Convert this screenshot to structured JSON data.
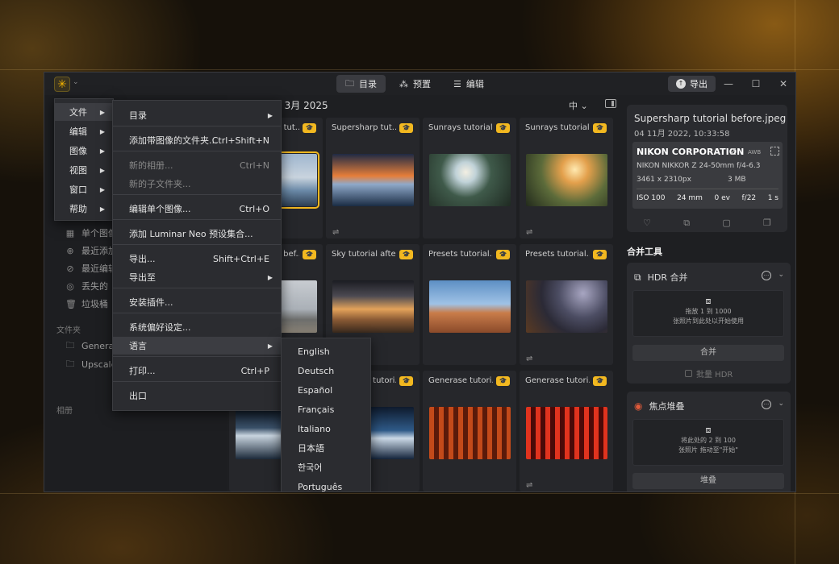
{
  "titlebar": {
    "tabs": [
      {
        "label": "目录",
        "icon": "folder-icon",
        "active": true
      },
      {
        "label": "预置",
        "icon": "magic-wand-icon",
        "active": false
      },
      {
        "label": "编辑",
        "icon": "sliders-icon",
        "active": false
      }
    ],
    "export_label": "导出"
  },
  "main_menu": {
    "items": [
      {
        "label": "文件"
      },
      {
        "label": "编辑"
      },
      {
        "label": "图像"
      },
      {
        "label": "视图"
      },
      {
        "label": "窗口"
      },
      {
        "label": "帮助"
      }
    ]
  },
  "file_menu": {
    "items": [
      {
        "label": "目录",
        "shortcut": "",
        "submenu": true,
        "disabled": false
      },
      {
        "label": "添加带图像的文件夹...",
        "shortcut": "Ctrl+Shift+N",
        "submenu": false,
        "disabled": false
      },
      {
        "label": "新的相册...",
        "shortcut": "Ctrl+N",
        "submenu": false,
        "disabled": true
      },
      {
        "label": "新的子文件夹...",
        "shortcut": "",
        "submenu": false,
        "disabled": true
      },
      {
        "label": "编辑单个图像...",
        "shortcut": "Ctrl+O",
        "submenu": false,
        "disabled": false
      },
      {
        "label": "添加 Luminar Neo 预设集合...",
        "shortcut": "",
        "submenu": false,
        "disabled": false
      },
      {
        "label": "导出...",
        "shortcut": "Shift+Ctrl+E",
        "submenu": false,
        "disabled": false
      },
      {
        "label": "导出至",
        "shortcut": "",
        "submenu": true,
        "disabled": false
      },
      {
        "label": "安装插件...",
        "shortcut": "",
        "submenu": false,
        "disabled": false
      },
      {
        "label": "系统偏好设定...",
        "shortcut": "",
        "submenu": false,
        "disabled": false
      },
      {
        "label": "语言",
        "shortcut": "",
        "submenu": true,
        "disabled": false
      },
      {
        "label": "打印...",
        "shortcut": "Ctrl+P",
        "submenu": false,
        "disabled": false
      },
      {
        "label": "出口",
        "shortcut": "",
        "submenu": false,
        "disabled": false
      }
    ]
  },
  "language_menu": {
    "items": [
      "English",
      "Deutsch",
      "Español",
      "Français",
      "Italiano",
      "日本語",
      "한국어",
      "Português"
    ]
  },
  "sidebar": {
    "items": [
      {
        "label": "单个图像",
        "icon": "grid-icon"
      },
      {
        "label": "最近添加",
        "icon": "clock-add-icon"
      },
      {
        "label": "最近编辑",
        "icon": "clock-edit-icon"
      },
      {
        "label": "丢失的",
        "icon": "lost-icon"
      },
      {
        "label": "垃圾桶",
        "icon": "trash-icon"
      }
    ],
    "folders_label": "文件夹",
    "folders": [
      {
        "label": "Genera",
        "icon": "folder-icon"
      },
      {
        "label": "Upscale",
        "icon": "folder-icon"
      }
    ],
    "albums_label": "相册"
  },
  "grid": {
    "date_header": "2月 2019 – 3月 2025",
    "zoom_label": "中",
    "cards": [
      {
        "title": "Supersharp tut...",
        "row": 0,
        "col": 0
      },
      {
        "title": "Supersharp tut...",
        "row": 0,
        "col": 1
      },
      {
        "title": "Sunrays tutorial...",
        "row": 0,
        "col": 2
      },
      {
        "title": "Sunrays tutorial...",
        "row": 0,
        "col": 3
      },
      {
        "title": "Sky tutorial bef...",
        "row": 1,
        "col": 0
      },
      {
        "title": "Sky tutorial after",
        "row": 1,
        "col": 1
      },
      {
        "title": "Presets tutorial...",
        "row": 1,
        "col": 2
      },
      {
        "title": "Presets tutorial...",
        "row": 1,
        "col": 3
      },
      {
        "title": "Generase tutori...",
        "row": 2,
        "col": 0
      },
      {
        "title": "Generase tutori...",
        "row": 2,
        "col": 1
      },
      {
        "title": "Generase tutori...",
        "row": 2,
        "col": 2
      },
      {
        "title": "Generase tutori...",
        "row": 2,
        "col": 3
      }
    ]
  },
  "info": {
    "filename": "Supersharp tutorial before.jpeg",
    "date": "04 11月 2022, 10:33:58",
    "camera": "NIKON CORPORATION",
    "camera_model": "Z",
    "wb": "AWB",
    "lens": "NIKON NIKKOR Z 24-50mm f/4-6.3",
    "resolution": "3461 x 2310px",
    "filesize": "3 MB",
    "iso": "ISO 100",
    "focal": "24 mm",
    "ev": "0 ev",
    "aperture": "f/22",
    "shutter": "1 s"
  },
  "tools": {
    "title": "合并工具",
    "hdr": {
      "name": "HDR 合并",
      "drop_line1": "拖放 1 到 1000",
      "drop_line2": "张照片到此处以开始使用",
      "button": "合并",
      "checkbox": "批量 HDR"
    },
    "focus": {
      "name": "焦点堆叠",
      "drop_line1": "将此处的 2 到 100",
      "drop_line2": "张照片 拖动至\"开始\"",
      "button": "堆叠"
    }
  },
  "colors": {
    "accent": "#f2b820",
    "window_bg": "#1e1f22",
    "menu_bg": "#2b2c30"
  }
}
